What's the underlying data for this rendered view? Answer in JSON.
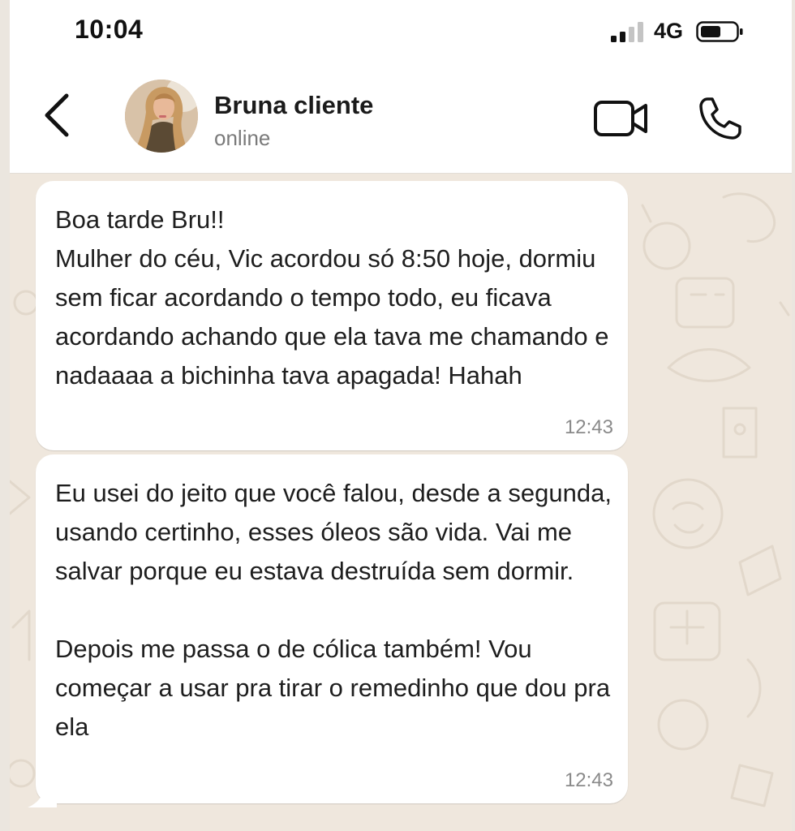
{
  "status_bar": {
    "time": "10:04",
    "network": "4G"
  },
  "chat_header": {
    "contact_name": "Bruna cliente",
    "presence": "online"
  },
  "messages": [
    {
      "direction": "incoming",
      "text": "Boa tarde Bru!!\nMulher do céu, Vic acordou só 8:50 hoje, dormiu sem ficar acordando o tempo todo, eu ficava acordando achando que ela tava me chamando e nadaaaa a bichinha tava apagada! Hahah",
      "time": "12:43"
    },
    {
      "direction": "incoming",
      "text": "Eu usei do jeito que você falou, desde a segunda, usando certinho, esses óleos são vida. Vai me salvar porque eu estava destruída sem dormir.\n\nDepois me passa o de cólica também! Vou começar a usar pra tirar o remedinho que dou pra ela",
      "time": "12:43"
    }
  ],
  "colors": {
    "wallpaper": "#efe7dd",
    "bubble": "#ffffff",
    "header": "#ffffff"
  },
  "icons": {
    "back": "chevron-left-icon",
    "video": "video-camera-icon",
    "call": "phone-icon"
  }
}
